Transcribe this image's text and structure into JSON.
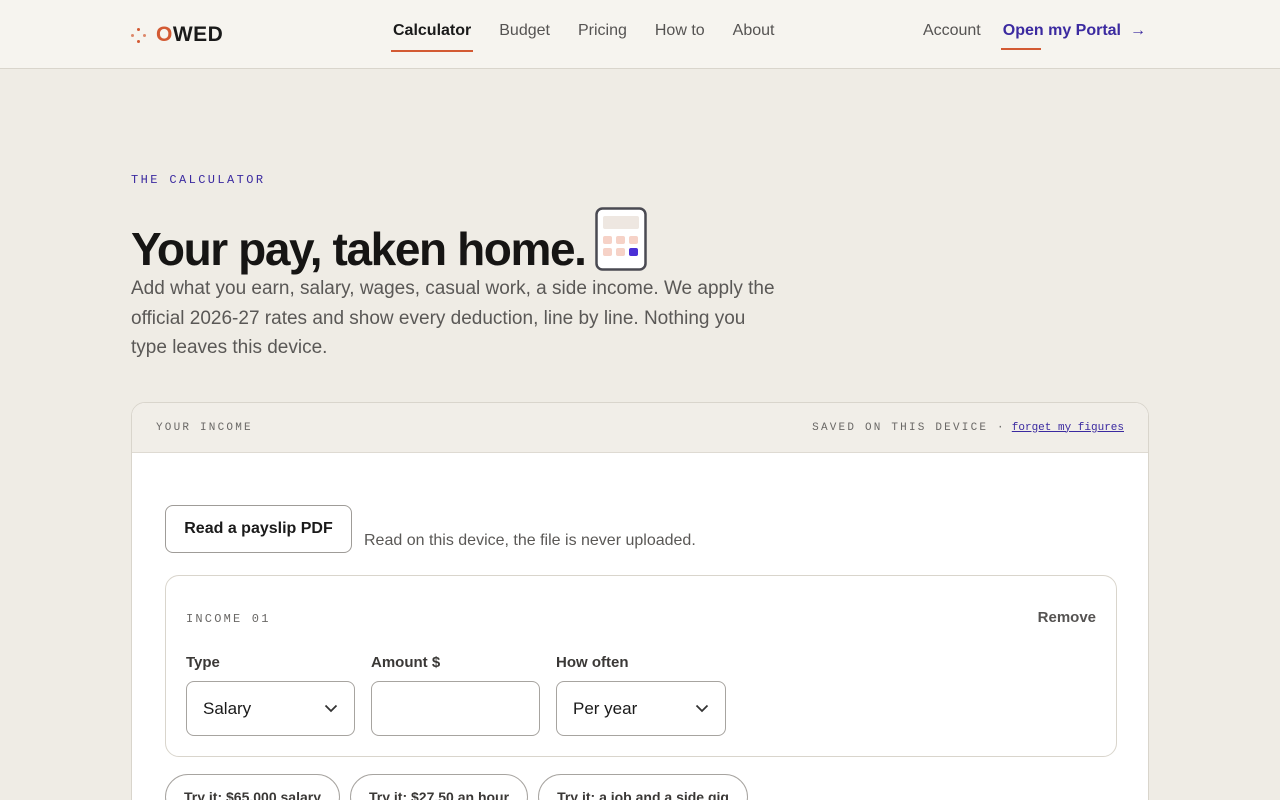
{
  "brand": {
    "name": "OWED",
    "accent": "#d35a33",
    "link_color": "#3b2aa0"
  },
  "nav": {
    "links": [
      {
        "label": "Calculator",
        "active": true
      },
      {
        "label": "Budget"
      },
      {
        "label": "Pricing"
      },
      {
        "label": "How to"
      },
      {
        "label": "About"
      }
    ],
    "account": "Account",
    "portal": "Open my Portal",
    "portal_arrow": "→"
  },
  "hero": {
    "eyebrow": "THE CALCULATOR",
    "title": "Your pay, taken home.",
    "description": "Add what you earn, salary, wages, casual work, a side income. We apply the official 2026-27 rates and show every deduction, line by line. Nothing you type leaves this device."
  },
  "card": {
    "header_label": "YOUR INCOME",
    "saved_text": "SAVED ON THIS DEVICE ·",
    "forget_link": "forget my figures",
    "payslip_button": "Read a payslip PDF",
    "payslip_note": "Read on this device, the file is never uploaded.",
    "income": {
      "label": "INCOME 01",
      "remove": "Remove",
      "type_label": "Type",
      "type_value": "Salary",
      "amount_label": "Amount $",
      "amount_value": "",
      "freq_label": "How often",
      "freq_value": "Per year"
    },
    "examples": [
      "Try it: $65,000 salary",
      "Try it: $27.50 an hour",
      "Try it: a job and a side gig"
    ]
  }
}
